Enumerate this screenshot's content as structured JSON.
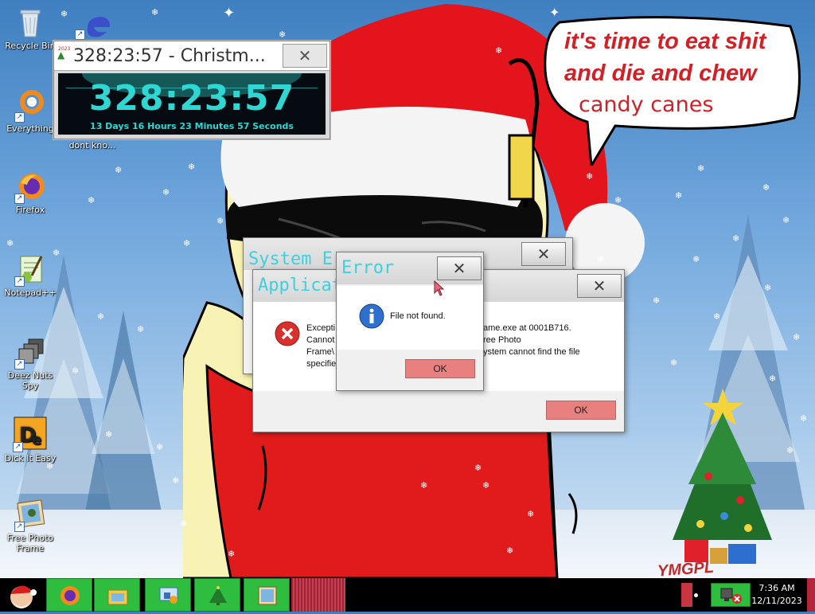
{
  "desktop": {
    "icons": [
      {
        "label": "Recycle Bin",
        "icon": "recycle-bin-icon"
      },
      {
        "label": "Everything",
        "icon": "everything-search-icon"
      },
      {
        "label": "dont kno...",
        "icon": "edge-browser-icon"
      },
      {
        "label": "Firefox",
        "icon": "firefox-icon"
      },
      {
        "label": "Notepad++",
        "icon": "notepad-plus-plus-icon"
      },
      {
        "label": "Deez Nuts Spy",
        "icon": "windows-stack-icon"
      },
      {
        "label": "Dick It Easy",
        "icon": "dick-it-easy-icon"
      },
      {
        "label": "Free Photo Frame",
        "icon": "photo-frame-icon"
      }
    ],
    "wallpaper_text": {
      "line1": "it's time to eat shit",
      "line2": "and die and chew",
      "line3": "candy canes",
      "watermark": "YMGPL"
    }
  },
  "countdown": {
    "title": "328:23:57 - Christm...",
    "big_time": "328:23:57",
    "sub_time": "13 Days 16 Hours 23 Minutes 57 Seconds",
    "badge": "2023"
  },
  "dialogs": {
    "system_error": {
      "title": "System Error",
      "title_visible": "System E"
    },
    "app_error": {
      "title": "Application Error",
      "title_visible": "Applicat",
      "message_line1_left": "Excepti",
      "message_line1_right": "ame.exe at 0001B716.",
      "message_line2_left": "Cannot",
      "message_line2_right": "ree Photo",
      "message_line3_left": "Frame\\",
      "message_line3_right": "ystem cannot find the file",
      "message_line4_left": "specifie",
      "ok_label": "OK"
    },
    "file_error": {
      "title": "Error",
      "message": "File not found.",
      "ok_label": "OK"
    }
  },
  "taskbar": {
    "start": "santa-start-icon",
    "pinned": [
      "firefox-icon",
      "file-explorer-icon",
      "control-panel-icon",
      "christmas-tree-icon",
      "photo-frame-icon"
    ],
    "clock_time": "7:36 AM",
    "clock_date": "12/11/2023"
  },
  "colors": {
    "taskbar_button": "#2ebd3e",
    "dialog_title_text": "#3fd0e0",
    "ok_button": "#e8807f",
    "countdown_text": "#2fd7d3"
  }
}
